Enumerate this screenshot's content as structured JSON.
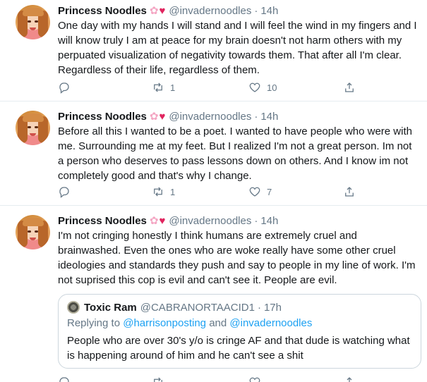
{
  "tweets": [
    {
      "name": "Princess Noodles",
      "emoji": [
        "cherry-blossom",
        "heart"
      ],
      "handle": "@invadernoodles",
      "time": "14h",
      "text": "One day with my hands I will stand and I will feel the wind in my fingers and I\nwill know truly I am at peace for my brain doesn't not harm others with my\nperpuated visualization of negativity towards them. That after all I'm clear.\nRegardless of their life, regardless of them.",
      "replies": "",
      "retweets": "1",
      "likes": "10"
    },
    {
      "name": "Princess Noodles",
      "emoji": [
        "cherry-blossom",
        "heart"
      ],
      "handle": "@invadernoodles",
      "time": "14h",
      "text": "Before all this I wanted to be a poet. I wanted to have people who were with\nme. Surrounding me at my feet. But I realized I'm not a great person. Im not\na person who deserves to pass lessons down on others. And I know im not\ncompletely good and that's why I change.",
      "replies": "",
      "retweets": "1",
      "likes": "7"
    },
    {
      "name": "Princess Noodles",
      "emoji": [
        "cherry-blossom",
        "heart"
      ],
      "handle": "@invadernoodles",
      "time": "14h",
      "text": "I'm not cringing honestly I think humans are extremely cruel and\nbrainwashed. Even the ones who are woke really have some other cruel\nideologies and standards they push and say to people in my line of work. I'm\nnot suprised this cop is evil and can't see it. People are evil.",
      "quote": {
        "name": "Toxic Ram",
        "handle": "@CABRANORTAACID1",
        "time": "17h",
        "replying_prefix": "Replying to",
        "replying_user1": "@harrisonposting",
        "replying_and": "and",
        "replying_user2": "@invadernoodles",
        "text": "People who are over 30's y/o is cringe AF and that dude is watching what\nis happening around of him and he can't see a shit"
      }
    }
  ],
  "colors": {
    "text": "#14171a",
    "muted": "#657786",
    "link": "#1da1f2",
    "border": "#e6ecf0",
    "heart": "#e0245e"
  }
}
